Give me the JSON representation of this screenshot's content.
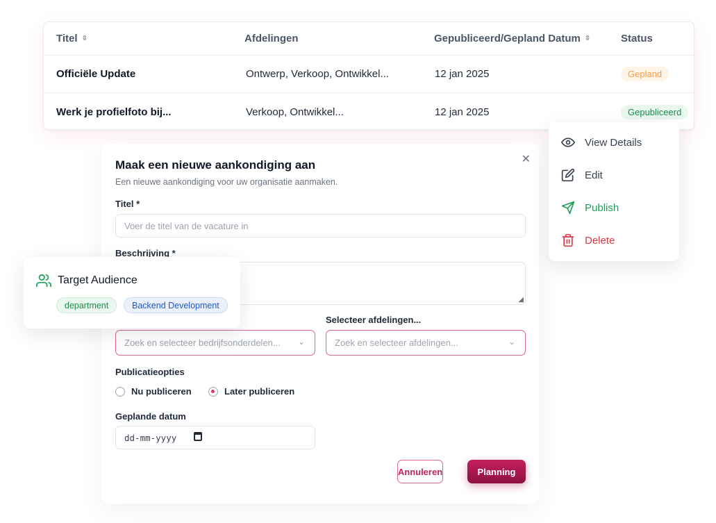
{
  "table": {
    "headers": {
      "title": "Titel",
      "departments": "Afdelingen",
      "date": "Gepubliceerd/Gepland Datum",
      "status": "Status"
    },
    "rows": [
      {
        "title": "Officiële Update",
        "departments": "Ontwerp, Verkoop, Ontwikkel...",
        "date": "12 jan 2025",
        "status": "Gepland"
      },
      {
        "title": "Werk je profielfoto bij...",
        "departments": "Verkoop, Ontwikkel...",
        "date": "12 jan 2025",
        "status": "Gepubliceerd"
      }
    ]
  },
  "dialog": {
    "title": "Maak een nieuwe aankondiging aan",
    "description": "Een nieuwe aankondiging voor uw organisatie aanmaken.",
    "title_label": "Titel *",
    "title_placeholder": "Voer de titel van de vacature in",
    "description_label": "Beschrijving *",
    "units_placeholder": "Zoek en selecteer bedrijfsonderdelen...",
    "departments_label": "Selecteer afdelingen...",
    "departments_placeholder": "Zoek en selecteer afdelingen...",
    "publish_options_label": "Publicatieopties",
    "publish_now": "Nu publiceren",
    "publish_later": "Later publiceren",
    "selected_option": "Later publiceren",
    "scheduled_date_label": "Geplande datum",
    "date_placeholder": "dd-mm-yyyy",
    "cancel_label": "Annuleren",
    "submit_label": "Planning"
  },
  "menu": {
    "items": [
      {
        "label": "View Details",
        "icon": "eye-icon"
      },
      {
        "label": "Edit",
        "icon": "edit-icon"
      },
      {
        "label": "Publish",
        "icon": "send-icon"
      },
      {
        "label": "Delete",
        "icon": "trash-icon"
      }
    ]
  },
  "audience": {
    "title": "Target Audience",
    "tags": [
      "department",
      "Backend Development"
    ]
  },
  "colors": {
    "accent": "#c41f5c",
    "planned": "#f59e4b",
    "published": "#1f8a4c",
    "delete": "#dc3c45"
  }
}
